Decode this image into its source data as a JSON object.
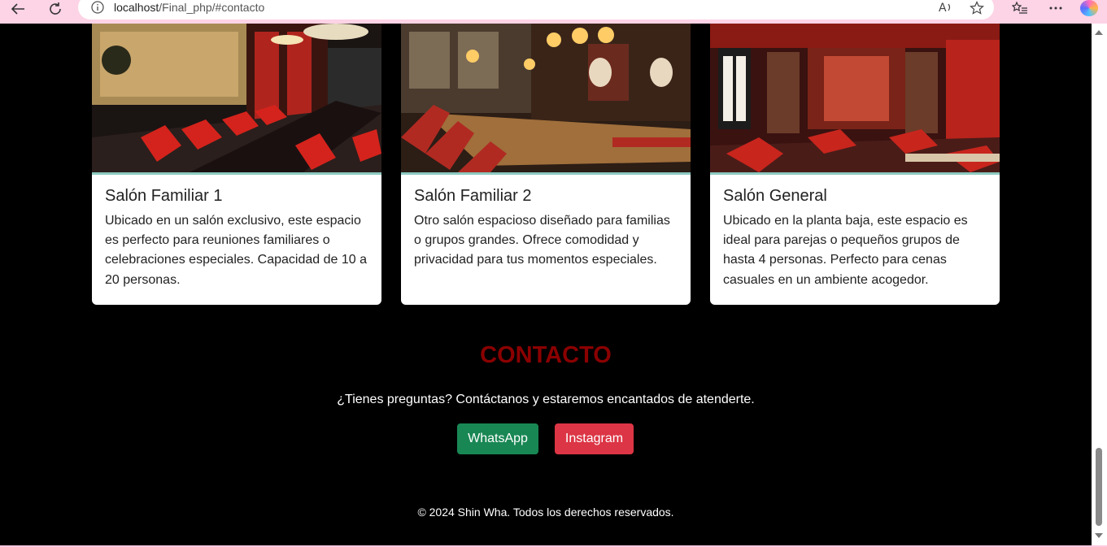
{
  "browser": {
    "url_host": "localhost",
    "url_path": "/Final_php/#contacto"
  },
  "rooms": [
    {
      "title": "Salón Familiar 1",
      "description": "Ubicado en un salón exclusivo, este espacio es perfecto para reuniones familiares o celebraciones especiales. Capacidad de 10 a 20 personas.",
      "image_alt": "private-dining-room-photo"
    },
    {
      "title": "Salón Familiar 2",
      "description": "Otro salón espacioso diseñado para familias o grupos grandes. Ofrece comodidad y privacidad para tus momentos especiales.",
      "image_alt": "family-dining-hall-photo"
    },
    {
      "title": "Salón General",
      "description": "Ubicado en la planta baja, este espacio es ideal para parejas o pequeños grupos de hasta 4 personas. Perfecto para cenas casuales en un ambiente acogedor.",
      "image_alt": "general-dining-room-photo"
    }
  ],
  "contact": {
    "title": "CONTACTO",
    "text": "¿Tienes preguntas? Contáctanos y estaremos encantados de atenderte.",
    "whatsapp_label": "WhatsApp",
    "instagram_label": "Instagram"
  },
  "footer": {
    "text": "© 2024 Shin Wha. Todos los derechos reservados."
  },
  "colors": {
    "accent_title": "#8b0000",
    "whatsapp": "#198754",
    "instagram": "#dc3545",
    "background": "#000000"
  }
}
